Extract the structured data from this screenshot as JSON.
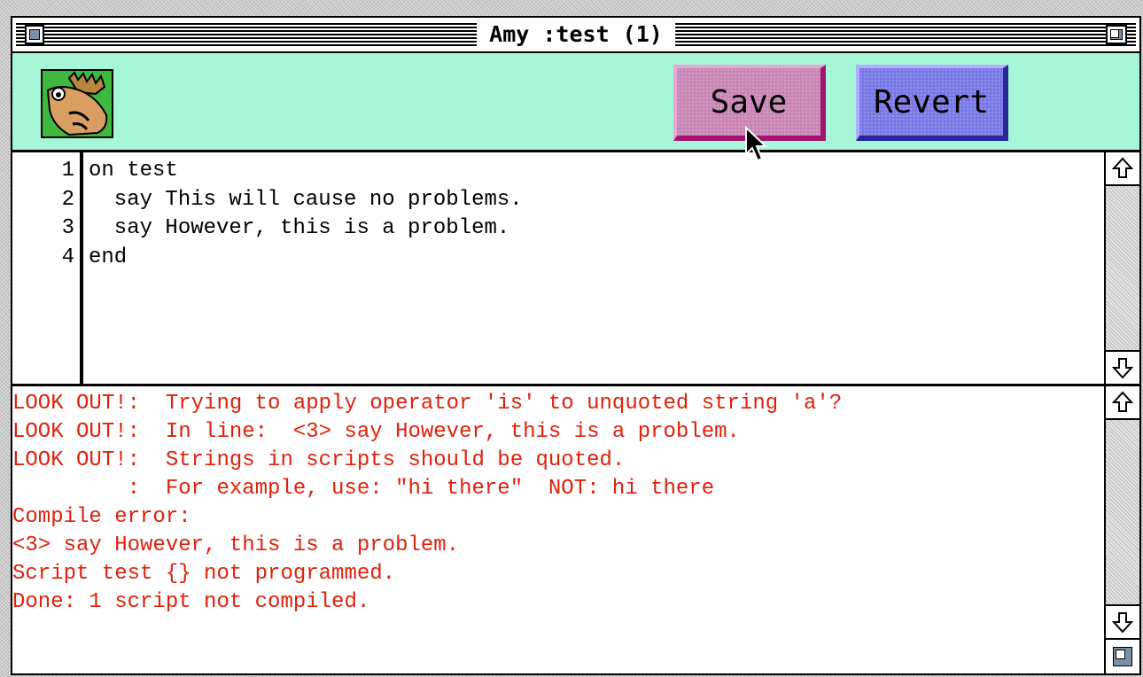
{
  "window": {
    "title": "Amy :test (1)"
  },
  "toolbar": {
    "save_label": "Save",
    "revert_label": "Revert"
  },
  "editor": {
    "lines": [
      {
        "num": "1",
        "text": "on test"
      },
      {
        "num": "2",
        "text": "  say This will cause no problems."
      },
      {
        "num": "3",
        "text": "  say However, this is a problem."
      },
      {
        "num": "4",
        "text": "end"
      }
    ]
  },
  "console": {
    "messages": [
      "LOOK OUT!:  Trying to apply operator 'is' to unquoted string 'a'?",
      "LOOK OUT!:  In line:  <3> say However, this is a problem.",
      "LOOK OUT!:  Strings in scripts should be quoted.",
      "         :  For example, use: \"hi there\"  NOT: hi there",
      "Compile error:",
      "<3> say However, this is a problem.",
      "Script test {} not programmed.",
      "Done: 1 script not compiled."
    ]
  },
  "colors": {
    "toolbar_bg": "#a6f7d8",
    "error_text": "#e0200a",
    "save_button": "#c986b5",
    "revert_button": "#7878e6"
  },
  "icons": {
    "app": "moose-icon",
    "close": "close-box-icon",
    "zoom": "zoom-box-icon",
    "up": "up-arrow-icon",
    "down": "down-arrow-icon",
    "cursor": "arrow-cursor-icon",
    "grow": "grow-box-icon"
  }
}
